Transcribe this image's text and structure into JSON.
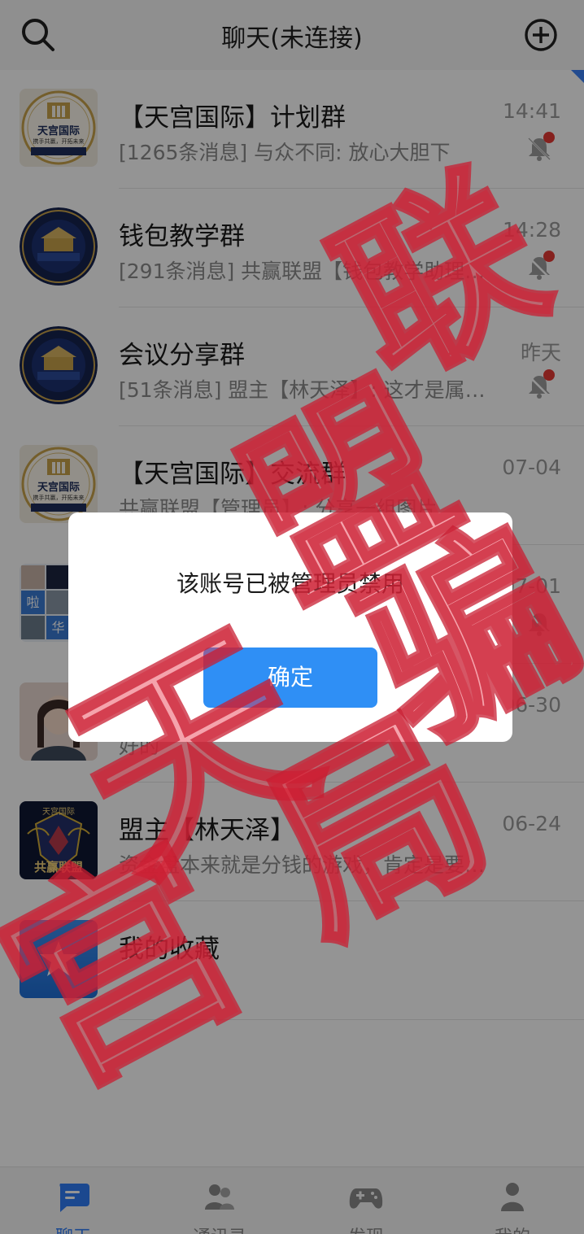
{
  "header": {
    "title": "聊天(未连接)",
    "search_icon": "search-icon",
    "add_icon": "plus-circle-icon"
  },
  "chats": [
    {
      "name": "【天宫国际】计划群",
      "preview": "[1265条消息] 与众不同: 放心大胆下",
      "time": "14:41",
      "muted": true,
      "unread_dot": true,
      "avatar": {
        "type": "logo-tiangong",
        "title": "天宫国际",
        "subtitle": "携手共赢，开拓未来"
      }
    },
    {
      "name": "钱包教学群",
      "preview": "[291条消息] 共赢联盟【钱包教学助理…",
      "time": "14:28",
      "muted": true,
      "unread_dot": true,
      "avatar": {
        "type": "seal-dark"
      }
    },
    {
      "name": "会议分享群",
      "preview": "[51条消息] 盟主【林天泽】: 这才是属…",
      "time": "昨天",
      "muted": true,
      "unread_dot": true,
      "avatar": {
        "type": "seal-dark"
      }
    },
    {
      "name": "【天宫国际】交流群",
      "preview": "共赢联盟【管理员】: 分享一组图片",
      "time": "07-04",
      "muted": false,
      "unread_dot": false,
      "avatar": {
        "type": "logo-tiangong",
        "title": "天宫国际",
        "subtitle": "携手共赢，开拓未来"
      }
    },
    {
      "name": "",
      "preview": "",
      "time": "07-01",
      "muted": true,
      "unread_dot": false,
      "avatar": {
        "type": "group-grid",
        "tiles": [
          "啦",
          "华"
        ]
      }
    },
    {
      "name": "",
      "preview": "好的",
      "time": "06-30",
      "muted": false,
      "unread_dot": false,
      "avatar": {
        "type": "portrait"
      }
    },
    {
      "name": "盟主【林天泽】",
      "preview": "资金盘本来就是分钱的游戏，肯定是要…",
      "time": "06-24",
      "muted": false,
      "unread_dot": false,
      "avatar": {
        "type": "badge-alliance",
        "top_text": "天宫国际",
        "bottom_text": "共赢联盟"
      }
    },
    {
      "name": "我的收藏",
      "preview": "",
      "time": "",
      "muted": false,
      "unread_dot": false,
      "avatar": {
        "type": "star-favorites"
      }
    }
  ],
  "dialog": {
    "message": "该账号已被管理员禁用",
    "confirm_label": "确定"
  },
  "bottom_nav": [
    {
      "label": "聊天",
      "icon": "chat-bubble-icon",
      "active": true
    },
    {
      "label": "通讯录",
      "icon": "contacts-icon",
      "active": false
    },
    {
      "label": "发现",
      "icon": "gamepad-icon",
      "active": false
    },
    {
      "label": "我的",
      "icon": "person-icon",
      "active": false
    }
  ],
  "watermark": {
    "text": [
      "联",
      "盟",
      "天",
      "宫",
      "骗",
      "局"
    ],
    "color": "#e0303f"
  },
  "colors": {
    "accent": "#2f8ff5",
    "active_nav": "#2f7cf6",
    "unread": "#e53935",
    "watermark": "#e0303f"
  }
}
